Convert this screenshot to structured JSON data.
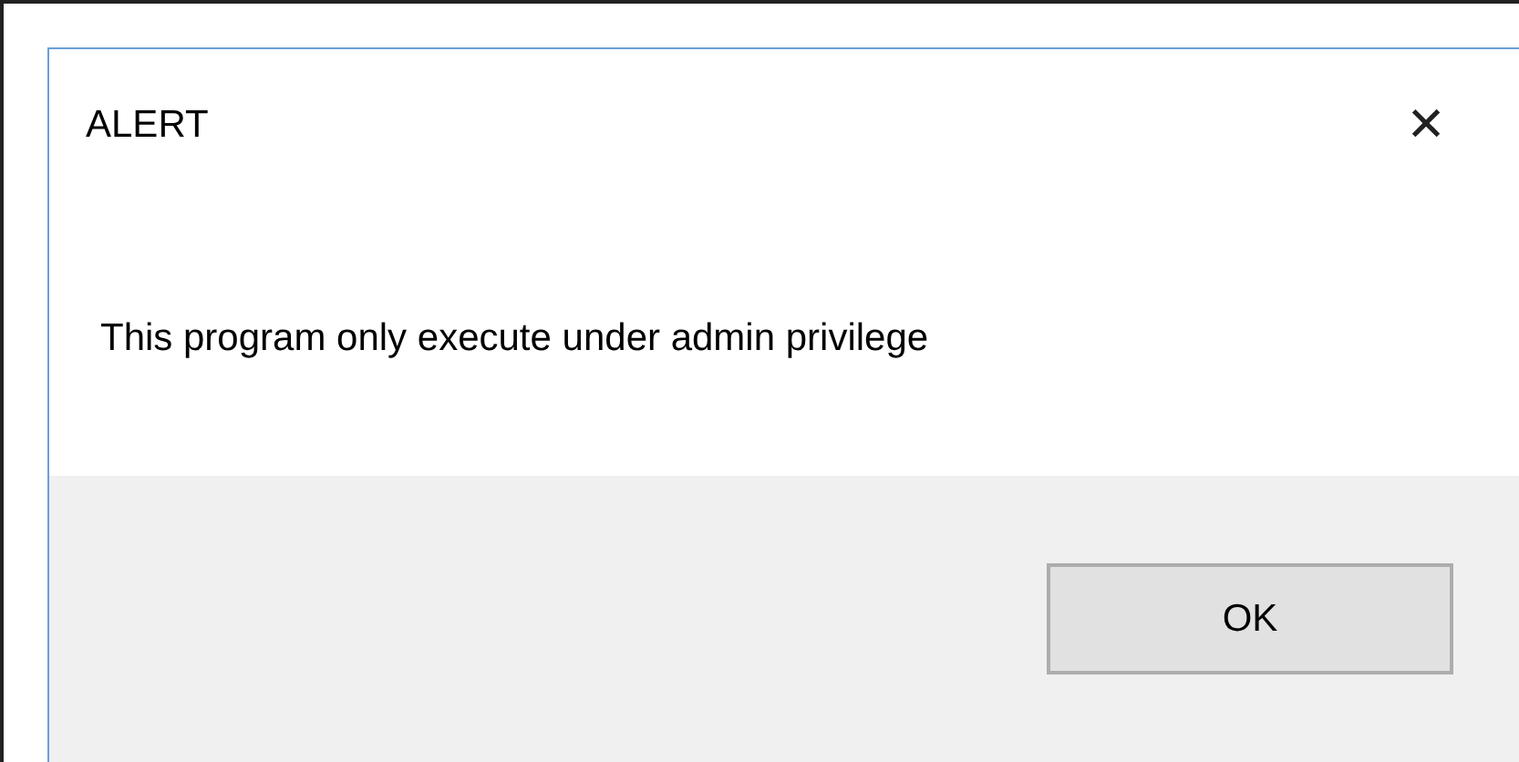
{
  "window": {
    "title": "ALERT",
    "close": "✕"
  },
  "message": "This program only execute under admin privilege",
  "buttons": [
    "OK"
  ]
}
